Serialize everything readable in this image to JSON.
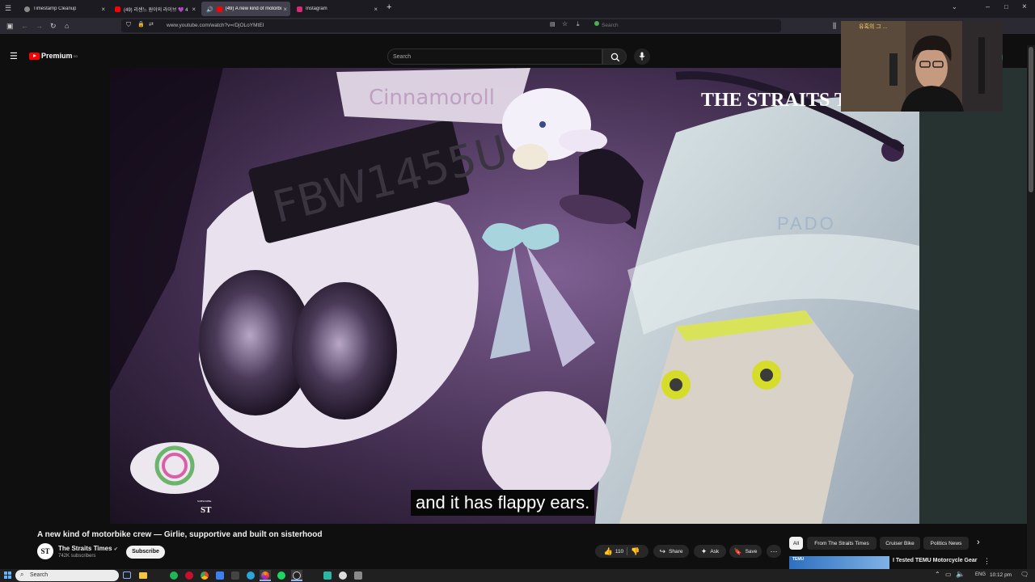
{
  "browser": {
    "tabs": [
      {
        "label": "Timestamp Cleanup",
        "color": "#8a8a8a"
      },
      {
        "label": "(49) 리센느 원이의 라이브 💜 4",
        "color": "#ff0000"
      },
      {
        "label": "(49) A new kind of motorbi",
        "color": "#ff0000"
      },
      {
        "label": "Instagram",
        "color": "#d62976"
      }
    ],
    "url": "www.youtube.com/watch?v=rDjOLoYMtEI",
    "search_placeholder": "Search"
  },
  "youtube": {
    "logo": "Premium",
    "logo_badge": "SG",
    "search_placeholder": "Search"
  },
  "video": {
    "watermark": "THE STRAITS TI",
    "caption": "and it has flappy ears.",
    "plate": "FBW1455U",
    "sticker_text": "Cinnamoroll",
    "tank_text": "PADO",
    "corner_logo": "SUBSCRIBE",
    "corner_mark": "ST"
  },
  "meta": {
    "title": "A new kind of motorbike crew — Girlie, supportive and built on sisterhood",
    "channel": "The Straits Times",
    "channel_initials": "ST",
    "subscribers": "742K subscribers",
    "subscribe_label": "Subscribe",
    "likes": "110",
    "share": "Share",
    "ask": "Ask",
    "save": "Save"
  },
  "chips": [
    "All",
    "From The Straits Times",
    "Cruiser Bike",
    "Politics News"
  ],
  "recommendation": {
    "title": "I Tested TEMU Motorcycle Gear",
    "thumb_text": "TEMU"
  },
  "webcam": {
    "overlay_text": "유혹의 그 ..."
  },
  "taskbar": {
    "search": "Search",
    "lang": "ENG",
    "time": "10:12 pm"
  }
}
